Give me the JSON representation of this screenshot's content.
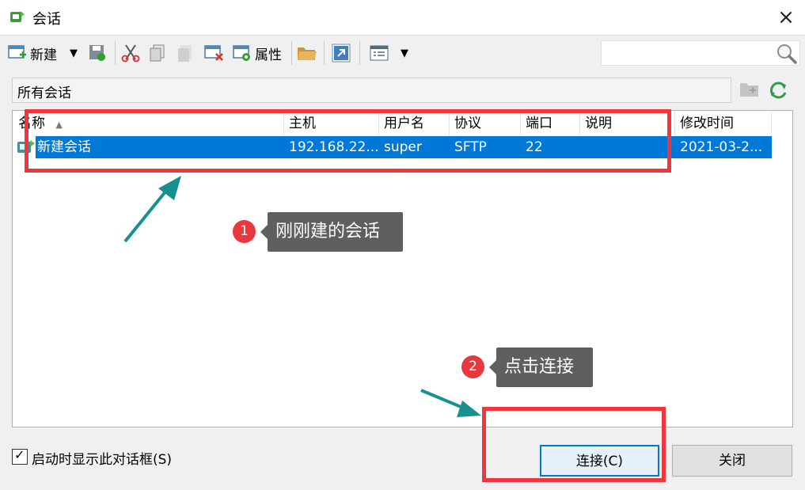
{
  "window": {
    "title": "会话",
    "close_glyph": "×"
  },
  "toolbar": {
    "new_label": "新建",
    "properties_label": "属性",
    "dropdown_glyph": "▼"
  },
  "search": {
    "placeholder": ""
  },
  "path_bar": {
    "text": "所有会话"
  },
  "table": {
    "columns": [
      "名称",
      "主机",
      "用户名",
      "协议",
      "端口",
      "说明",
      "修改时间"
    ],
    "sort_glyph": "▲",
    "rows": [
      {
        "name": "新建会话",
        "host": "192.168.22...",
        "user": "super",
        "protocol": "SFTP",
        "port": "22",
        "desc": "",
        "modified": "2021-03-2..."
      }
    ]
  },
  "footer": {
    "startup_label": "启动时显示此对话框(S)",
    "startup_checked": true,
    "check_glyph": "✓",
    "connect_label": "连接(C)",
    "close_label": "关闭"
  },
  "annotations": {
    "badge1": "1",
    "tip1": "刚刚建的会话",
    "badge2": "2",
    "tip2": "点击连接"
  },
  "colors": {
    "selection": "#0078d7",
    "annotation_red": "#f0353c",
    "arrow_teal": "#16918f",
    "tooltip_gray": "#5f5f5f"
  },
  "icons": [
    "app-icon",
    "new-session-icon",
    "save-icon",
    "cut-icon",
    "copy-icon",
    "paste-icon",
    "delete-icon",
    "properties-icon",
    "open-folder-icon",
    "shortcut-icon",
    "view-icon",
    "search-icon",
    "folder-icon",
    "refresh-icon",
    "session-icon"
  ]
}
